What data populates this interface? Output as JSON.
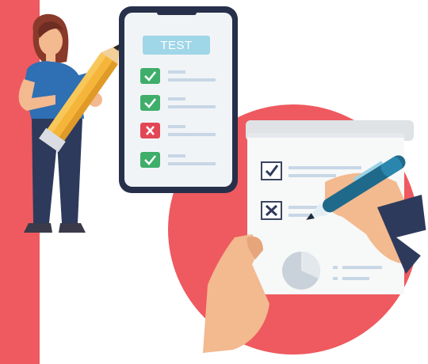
{
  "illustration": {
    "test_header_text": "TEST",
    "phone_checklist": [
      {
        "status": "pass",
        "icon": "check-icon"
      },
      {
        "status": "pass",
        "icon": "check-icon"
      },
      {
        "status": "fail",
        "icon": "cross-icon"
      },
      {
        "status": "pass",
        "icon": "check-icon"
      }
    ],
    "paper_checklist": [
      {
        "status": "checked",
        "icon": "check-icon"
      },
      {
        "status": "crossed",
        "icon": "cross-icon"
      }
    ],
    "colors": {
      "coral": "#ee5a5f",
      "header_blue": "#9fd6e8",
      "check_green": "#3fae6a",
      "cross_red": "#e34655",
      "phone_frame": "#26304a",
      "paper": "#f7f8f8",
      "pencil_yellow": "#f4b53a",
      "shirt_blue": "#2f6fb3",
      "pants_navy": "#2d3a5c",
      "pen_teal": "#1f6a8a"
    }
  }
}
